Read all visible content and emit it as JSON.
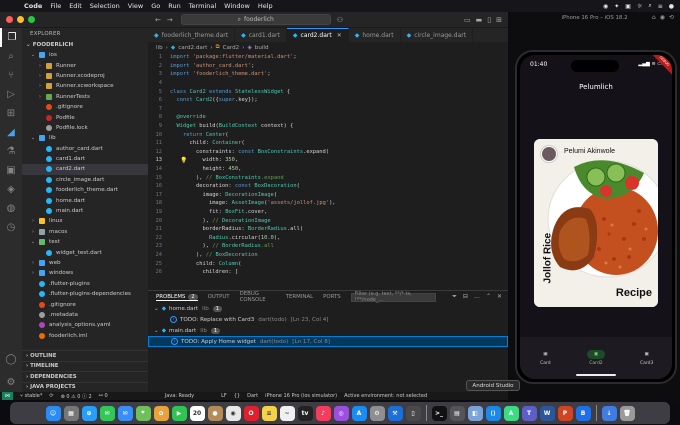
{
  "menubar": {
    "apple_glyph": "",
    "items": [
      "Code",
      "File",
      "Edit",
      "Selection",
      "View",
      "Go",
      "Run",
      "Terminal",
      "Window",
      "Help"
    ],
    "right": [
      "◉",
      "✦",
      "▣",
      "☼",
      "⌕",
      "≡",
      "●"
    ]
  },
  "vscode": {
    "title_search": "fooderlich",
    "explorer": {
      "header": "EXPLORER",
      "project": "FOODERLICH",
      "tree": [
        {
          "label": "ios",
          "type": "folder",
          "open": true,
          "indent": 1,
          "icon": "#42a5f5"
        },
        {
          "label": "Runner",
          "type": "folder",
          "open": false,
          "indent": 2,
          "icon": "#cfa23b"
        },
        {
          "label": "Runner.xcodeproj",
          "type": "folder",
          "open": false,
          "indent": 2,
          "icon": "#cfa23b"
        },
        {
          "label": "Runner.xcworkspace",
          "type": "folder",
          "open": false,
          "indent": 2,
          "icon": "#cfa23b"
        },
        {
          "label": "RunnerTests",
          "type": "folder",
          "open": false,
          "indent": 2,
          "icon": "#6aa84f"
        },
        {
          "label": ".gitignore",
          "type": "file",
          "indent": 2,
          "icon": "#e64a19"
        },
        {
          "label": "Podfile",
          "type": "file",
          "indent": 2,
          "icon": "#c62828"
        },
        {
          "label": "Podfile.lock",
          "type": "file",
          "indent": 2,
          "icon": "#9e9e9e"
        },
        {
          "label": "lib",
          "type": "folder",
          "open": true,
          "indent": 1,
          "icon": "#42a5f5"
        },
        {
          "label": "author_card.dart",
          "type": "file",
          "indent": 2,
          "icon": "#29b6f6"
        },
        {
          "label": "card1.dart",
          "type": "file",
          "indent": 2,
          "icon": "#29b6f6"
        },
        {
          "label": "card2.dart",
          "type": "file",
          "indent": 2,
          "icon": "#29b6f6",
          "selected": true
        },
        {
          "label": "circle_image.dart",
          "type": "file",
          "indent": 2,
          "icon": "#29b6f6"
        },
        {
          "label": "fooderlich_theme.dart",
          "type": "file",
          "indent": 2,
          "icon": "#29b6f6"
        },
        {
          "label": "home.dart",
          "type": "file",
          "indent": 2,
          "icon": "#29b6f6"
        },
        {
          "label": "main.dart",
          "type": "file",
          "indent": 2,
          "icon": "#29b6f6"
        },
        {
          "label": "linux",
          "type": "folder",
          "open": false,
          "indent": 1,
          "icon": "#fbc02d"
        },
        {
          "label": "macos",
          "type": "folder",
          "open": false,
          "indent": 1,
          "icon": "#90a4ae"
        },
        {
          "label": "test",
          "type": "folder",
          "open": true,
          "indent": 1,
          "icon": "#66bb6a"
        },
        {
          "label": "widget_test.dart",
          "type": "file",
          "indent": 2,
          "icon": "#29b6f6"
        },
        {
          "label": "web",
          "type": "folder",
          "open": false,
          "indent": 1,
          "icon": "#42a5f5"
        },
        {
          "label": "windows",
          "type": "folder",
          "open": false,
          "indent": 1,
          "icon": "#42a5f5"
        },
        {
          "label": ".flutter-plugins",
          "type": "file",
          "indent": 1,
          "icon": "#29b6f6"
        },
        {
          "label": ".flutter-plugins-dependencies",
          "type": "file",
          "indent": 1,
          "icon": "#29b6f6"
        },
        {
          "label": ".gitignore",
          "type": "file",
          "indent": 1,
          "icon": "#e64a19"
        },
        {
          "label": ".metadata",
          "type": "file",
          "indent": 1,
          "icon": "#9e9e9e"
        },
        {
          "label": "analysis_options.yaml",
          "type": "file",
          "indent": 1,
          "icon": "#ab47bc"
        },
        {
          "label": "fooderlich.iml",
          "type": "file",
          "indent": 1,
          "icon": "#ef6c00"
        }
      ],
      "sections": [
        "OUTLINE",
        "TIMELINE",
        "DEPENDENCIES",
        "JAVA PROJECTS"
      ]
    },
    "tabs": [
      {
        "label": "fooderlich_theme.dart",
        "active": false
      },
      {
        "label": "card1.dart",
        "active": false
      },
      {
        "label": "card2.dart",
        "active": true
      },
      {
        "label": "home.dart",
        "active": false
      },
      {
        "label": "circle_image.dart",
        "active": false
      }
    ],
    "breadcrumb": [
      "lib",
      "card2.dart",
      "Card2",
      "build"
    ],
    "code": [
      {
        "n": "1",
        "t": "import 'package:flutter/material.dart';"
      },
      {
        "n": "2",
        "t": "import 'author_card.dart';"
      },
      {
        "n": "3",
        "t": "import 'fooderlich_theme.dart';"
      },
      {
        "n": "4",
        "t": ""
      },
      {
        "n": "5",
        "t": "class Card2 extends StatelessWidget {"
      },
      {
        "n": "6",
        "t": "  const Card2({super.key});"
      },
      {
        "n": "7",
        "t": ""
      },
      {
        "n": "8",
        "t": "  @override"
      },
      {
        "n": "9",
        "t": "  Widget build(BuildContext context) {"
      },
      {
        "n": "10",
        "t": "    return Center("
      },
      {
        "n": "11",
        "t": "      child: Container("
      },
      {
        "n": "12",
        "t": "        constraints: const BoxConstraints.expand("
      },
      {
        "n": "13",
        "t": "          width: 350,",
        "cur": true
      },
      {
        "n": "14",
        "t": "          height: 450,"
      },
      {
        "n": "15",
        "t": "        ), // BoxConstraints.expand"
      },
      {
        "n": "16",
        "t": "        decoration: const BoxDecoration("
      },
      {
        "n": "17",
        "t": "          image: DecorationImage("
      },
      {
        "n": "18",
        "t": "            image: AssetImage('assets/jollof.jpg'),"
      },
      {
        "n": "19",
        "t": "            fit: BoxFit.cover,"
      },
      {
        "n": "20",
        "t": "          ), // DecorationImage"
      },
      {
        "n": "21",
        "t": "          borderRadius: BorderRadius.all("
      },
      {
        "n": "22",
        "t": "            Radius.circular(10.0),"
      },
      {
        "n": "23",
        "t": "          ), // BorderRadius.all"
      },
      {
        "n": "24",
        "t": "        ), // BoxDecoration"
      },
      {
        "n": "25",
        "t": "        child: Column("
      },
      {
        "n": "26",
        "t": "          children: ["
      }
    ],
    "panel": {
      "tabs": [
        "PROBLEMS",
        "OUTPUT",
        "DEBUG CONSOLE",
        "TERMINAL",
        "PORTS"
      ],
      "problems_count": "2",
      "filter_placeholder": "Filter (e.g. text, **/*.ts, !**/node_...",
      "files": [
        {
          "name": "home.dart",
          "folder": "lib",
          "count": "1",
          "todo": "TODO: Replace with Card3",
          "source": "dart(todo)",
          "loc": "[Ln 23, Col 4]"
        },
        {
          "name": "main.dart",
          "folder": "lib",
          "count": "1",
          "todo": "TODO: Apply Home widget",
          "source": "dart(todo)",
          "loc": "[Ln 17, Col 8]"
        }
      ]
    },
    "statusbar": {
      "branch": "stable*",
      "sync": "⟳",
      "problems": "⊗ 0 ⚠ 0 ⓘ 2",
      "ports": "⚯ 0",
      "java": "Java: Ready",
      "eol": "LF",
      "braces": "{}",
      "lang": "Dart",
      "device": "iPhone 16 Pro (ios simulator)",
      "env": "Active environment: not selected"
    }
  },
  "simulator": {
    "title": "iPhone 16 Pro – iOS 18.2",
    "time": "01:40",
    "debug_banner": "DEBUG",
    "app_title": "Pelumlich",
    "card": {
      "author": "Pelumi Akinwole",
      "title": "Jollof Rice",
      "subtitle": "Recipe"
    },
    "nav": [
      {
        "label": "Card",
        "active": false
      },
      {
        "label": "Card2",
        "active": true
      },
      {
        "label": "Card3",
        "active": false
      }
    ]
  },
  "tooltip": "Android Studio",
  "dock": [
    {
      "name": "finder",
      "color": "#2b8cf1",
      "glyph": "☺"
    },
    {
      "name": "launchpad",
      "color": "#777",
      "glyph": "▦"
    },
    {
      "name": "safari",
      "color": "#2a9df4",
      "glyph": "⊕"
    },
    {
      "name": "messages",
      "color": "#33c759",
      "glyph": "✉"
    },
    {
      "name": "mail",
      "color": "#3a8ff7",
      "glyph": "✉"
    },
    {
      "name": "maps",
      "color": "#6fbf5a",
      "glyph": "⌖"
    },
    {
      "name": "photos",
      "color": "#e8a33d",
      "glyph": "✿"
    },
    {
      "name": "facetime",
      "color": "#31c452",
      "glyph": "▶"
    },
    {
      "name": "calendar",
      "color": "#ffffff",
      "glyph": "20"
    },
    {
      "name": "contacts",
      "color": "#b58b5a",
      "glyph": "●"
    },
    {
      "name": "chrome",
      "color": "#e8e8e8",
      "glyph": "◉"
    },
    {
      "name": "opera",
      "color": "#e0202c",
      "glyph": "O"
    },
    {
      "name": "notes",
      "color": "#f4d24b",
      "glyph": "≡"
    },
    {
      "name": "freeform",
      "color": "#f0f0f0",
      "glyph": "~"
    },
    {
      "name": "tv",
      "color": "#222",
      "glyph": "tv"
    },
    {
      "name": "music",
      "color": "#f23e5c",
      "glyph": "♪"
    },
    {
      "name": "podcasts",
      "color": "#9b4fdd",
      "glyph": "◎"
    },
    {
      "name": "appstore",
      "color": "#1a8cf2",
      "glyph": "A"
    },
    {
      "name": "settings",
      "color": "#8e8e93",
      "glyph": "⚙"
    },
    {
      "name": "xcode",
      "color": "#1d6fd6",
      "glyph": "⚒"
    },
    {
      "name": "simulator",
      "color": "#4a4a4a",
      "glyph": "▯"
    },
    {
      "name": "sep1",
      "sep": true
    },
    {
      "name": "terminal",
      "color": "#111",
      "glyph": ">_"
    },
    {
      "name": "monitor",
      "color": "#555",
      "glyph": "▤"
    },
    {
      "name": "preview",
      "color": "#7aa4d9",
      "glyph": "◧"
    },
    {
      "name": "vscode",
      "color": "#1e88e5",
      "glyph": "⟨⟩"
    },
    {
      "name": "androidstudio",
      "color": "#3ddc84",
      "glyph": "A"
    },
    {
      "name": "teams",
      "color": "#5b5fc7",
      "glyph": "T"
    },
    {
      "name": "word",
      "color": "#2b579a",
      "glyph": "W"
    },
    {
      "name": "powerpoint",
      "color": "#d04423",
      "glyph": "P"
    },
    {
      "name": "bbedit",
      "color": "#1f6fe6",
      "glyph": "B"
    },
    {
      "name": "sep2",
      "sep": true
    },
    {
      "name": "downloads",
      "color": "#3f7de0",
      "glyph": "↓"
    },
    {
      "name": "trash",
      "color": "#9a9a9a",
      "glyph": "🗑"
    }
  ]
}
